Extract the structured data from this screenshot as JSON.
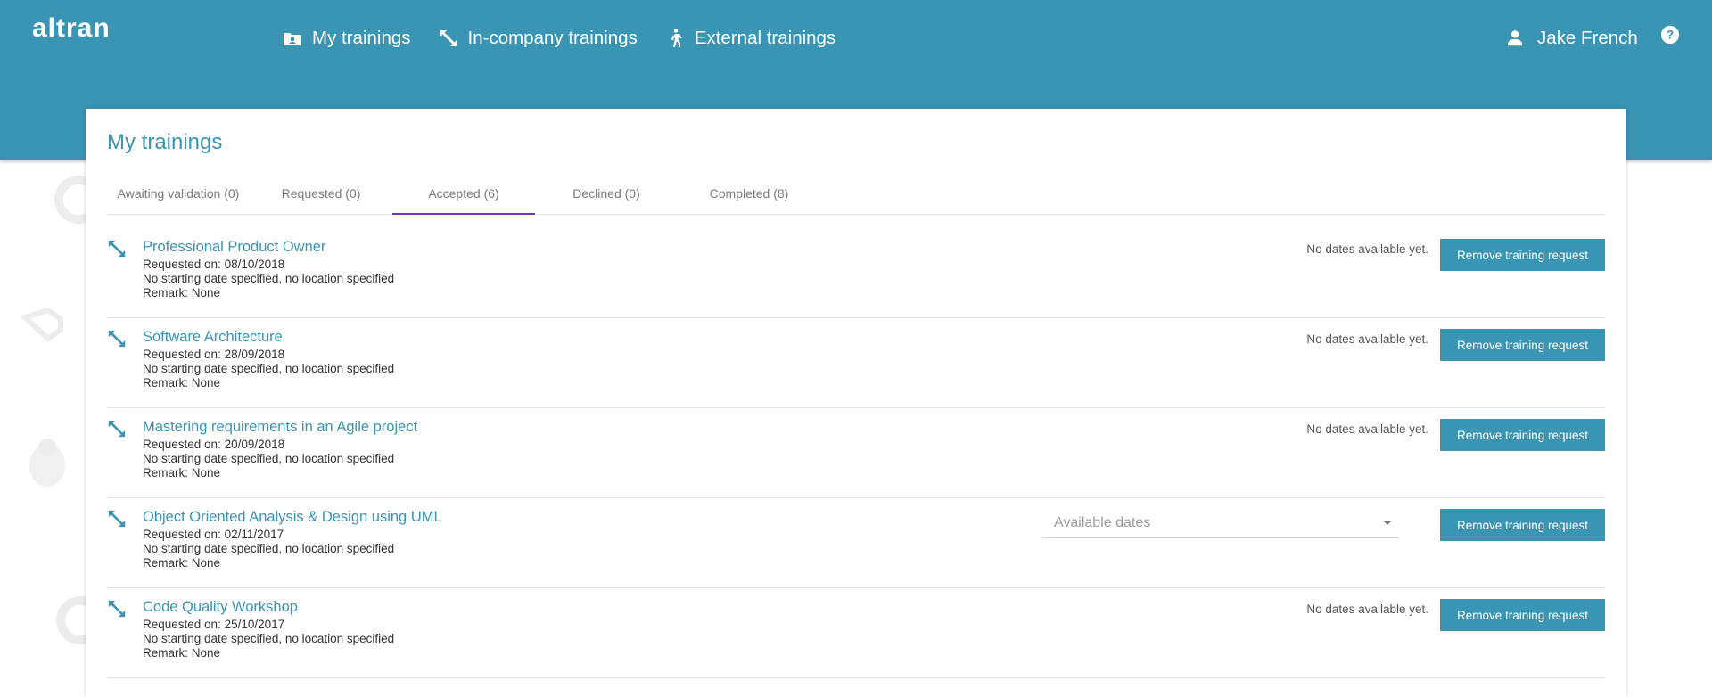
{
  "header": {
    "logo": "altran",
    "nav": [
      {
        "label": "My trainings",
        "icon": "training-icon"
      },
      {
        "label": "In-company trainings",
        "icon": "arrows-icon"
      },
      {
        "label": "External trainings",
        "icon": "walking-icon"
      }
    ],
    "user_name": "Jake French"
  },
  "page": {
    "title": "My trainings",
    "tabs": [
      {
        "label": "Awaiting validation (0)"
      },
      {
        "label": "Requested (0)"
      },
      {
        "label": "Accepted (6)",
        "active": true
      },
      {
        "label": "Declined (0)"
      },
      {
        "label": "Completed (8)"
      }
    ]
  },
  "trainings": [
    {
      "title": "Professional Product Owner",
      "requested": "Requested on: 08/10/2018",
      "details": "No starting date specified, no location specified",
      "remark": "Remark: None",
      "dates": "No dates available yet.",
      "action": "Remove training request"
    },
    {
      "title": "Software Architecture",
      "requested": "Requested on: 28/09/2018",
      "details": "No starting date specified, no location specified",
      "remark": "Remark: None",
      "dates": "No dates available yet.",
      "action": "Remove training request"
    },
    {
      "title": "Mastering requirements in an Agile project",
      "requested": "Requested on: 20/09/2018",
      "details": "No starting date specified, no location specified",
      "remark": "Remark: None",
      "dates": "No dates available yet.",
      "action": "Remove training request"
    },
    {
      "title": "Object Oriented Analysis & Design using UML",
      "requested": "Requested on: 02/11/2017",
      "details": "No starting date specified, no location specified",
      "remark": "Remark: None",
      "dates_placeholder": "Available dates",
      "action": "Remove training request"
    },
    {
      "title": "Code Quality Workshop",
      "requested": "Requested on: 25/10/2017",
      "details": "No starting date specified, no location specified",
      "remark": "Remark: None",
      "dates": "No dates available yet.",
      "action": "Remove training request"
    }
  ],
  "colors": {
    "primary": "#3a94b4",
    "active_tab": "#6f3bb5"
  }
}
